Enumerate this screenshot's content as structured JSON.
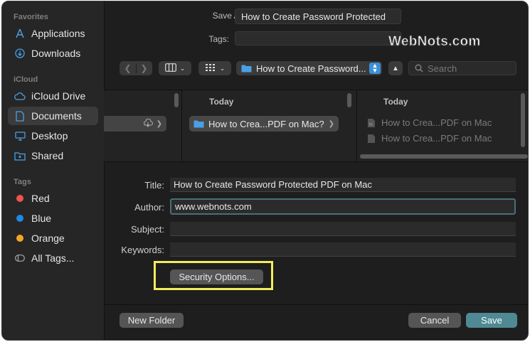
{
  "sidebar": {
    "favorites_header": "Favorites",
    "favorites": [
      {
        "label": "Applications",
        "icon": "applications-icon"
      },
      {
        "label": "Downloads",
        "icon": "downloads-icon"
      }
    ],
    "icloud_header": "iCloud",
    "icloud": [
      {
        "label": "iCloud Drive",
        "icon": "cloud-icon"
      },
      {
        "label": "Documents",
        "icon": "document-icon",
        "selected": true
      },
      {
        "label": "Desktop",
        "icon": "desktop-icon"
      },
      {
        "label": "Shared",
        "icon": "shared-folder-icon"
      }
    ],
    "tags_header": "Tags",
    "tags": [
      {
        "label": "Red",
        "color": "#ef5350"
      },
      {
        "label": "Blue",
        "color": "#1e88e5"
      },
      {
        "label": "Orange",
        "color": "#f5a623"
      },
      {
        "label": "All Tags...",
        "icon": "all-tags-icon"
      }
    ]
  },
  "save_as": {
    "label": "Save As:",
    "value": "How to Create Password Protected"
  },
  "tags_field": {
    "label": "Tags:",
    "value": ""
  },
  "toolbar": {
    "location": "How to Create Password...",
    "search_placeholder": "Search"
  },
  "browser": {
    "col2_header": "Today",
    "col2_item": "How to Crea...PDF on Mac?",
    "col3_header": "Today",
    "col3_items": [
      "How to Crea...PDF on Mac",
      "How to Crea...PDF on Mac"
    ]
  },
  "metadata": {
    "title_label": "Title:",
    "title_value": "How to Create Password Protected PDF on Mac",
    "author_label": "Author:",
    "author_value": "www.webnots.com",
    "subject_label": "Subject:",
    "subject_value": "",
    "keywords_label": "Keywords:",
    "keywords_value": ""
  },
  "buttons": {
    "security": "Security Options...",
    "new_folder": "New Folder",
    "cancel": "Cancel",
    "save": "Save"
  },
  "watermark": "WebNots.com",
  "colors": {
    "accent": "#3c8fd8",
    "save_button": "#4f8a94",
    "highlight": "#f3ec5b"
  }
}
